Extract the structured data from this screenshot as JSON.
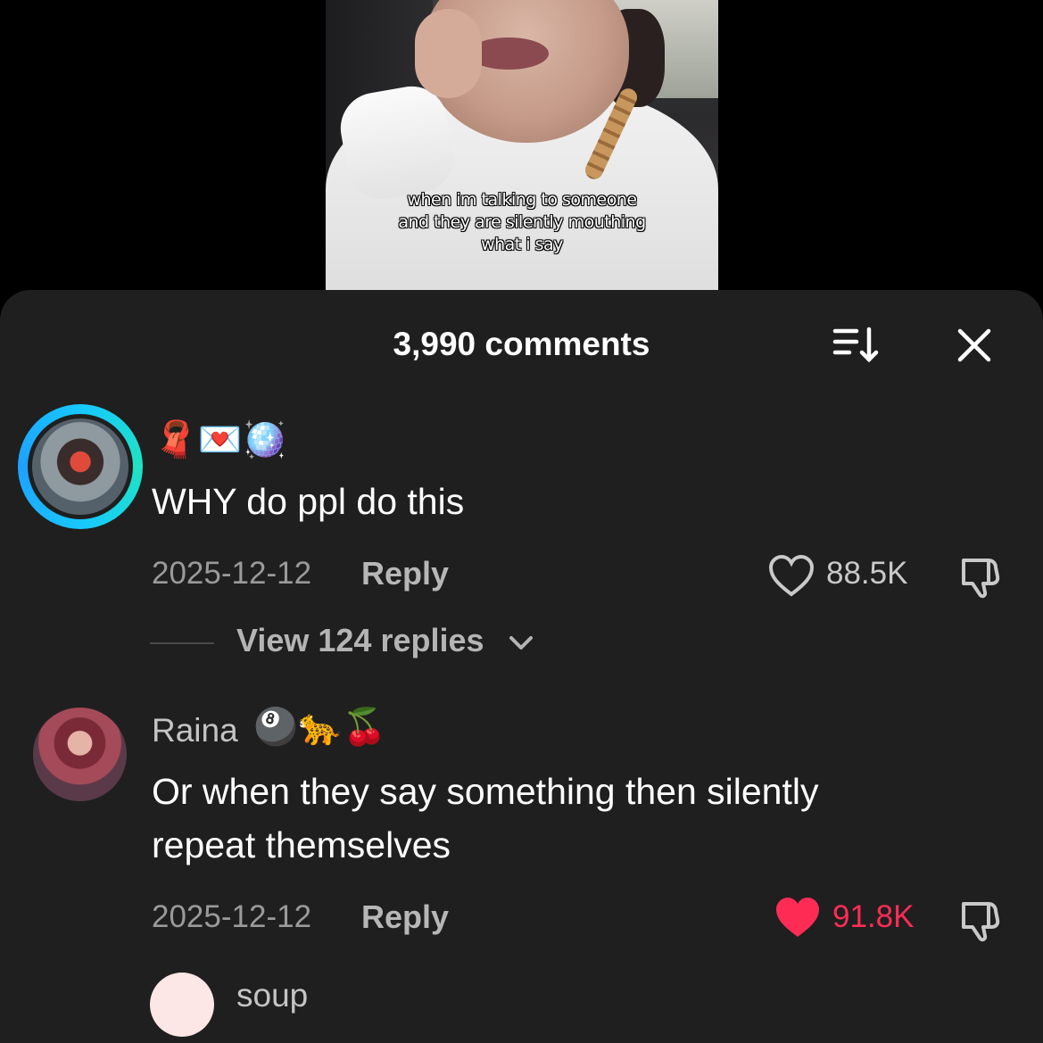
{
  "video": {
    "caption_lines": [
      "when im talking to someone",
      "and they are silently mouthing",
      "what i say"
    ]
  },
  "sheet": {
    "title": "3,990 comments",
    "sort_icon": "sort-icon",
    "close_icon": "close-icon"
  },
  "comments": [
    {
      "username": "",
      "username_emojis": "🧣💌🪩",
      "text": "WHY do ppl do this",
      "date": "2025-12-12",
      "reply_label": "Reply",
      "likes": "88.5K",
      "liked": false,
      "view_replies": "View 124 replies"
    },
    {
      "username": "Raina",
      "username_emojis": "🎱🐆🍒",
      "text_lines": [
        "Or when they say something then silently",
        "repeat themselves"
      ],
      "date": "2025-12-12",
      "reply_label": "Reply",
      "likes": "91.8K",
      "liked": true
    },
    {
      "username": "soup"
    }
  ],
  "colors": {
    "sheet_bg": "#1f1f1f",
    "liked_red": "#fe2c55",
    "muted_text": "#9a9a9a"
  }
}
